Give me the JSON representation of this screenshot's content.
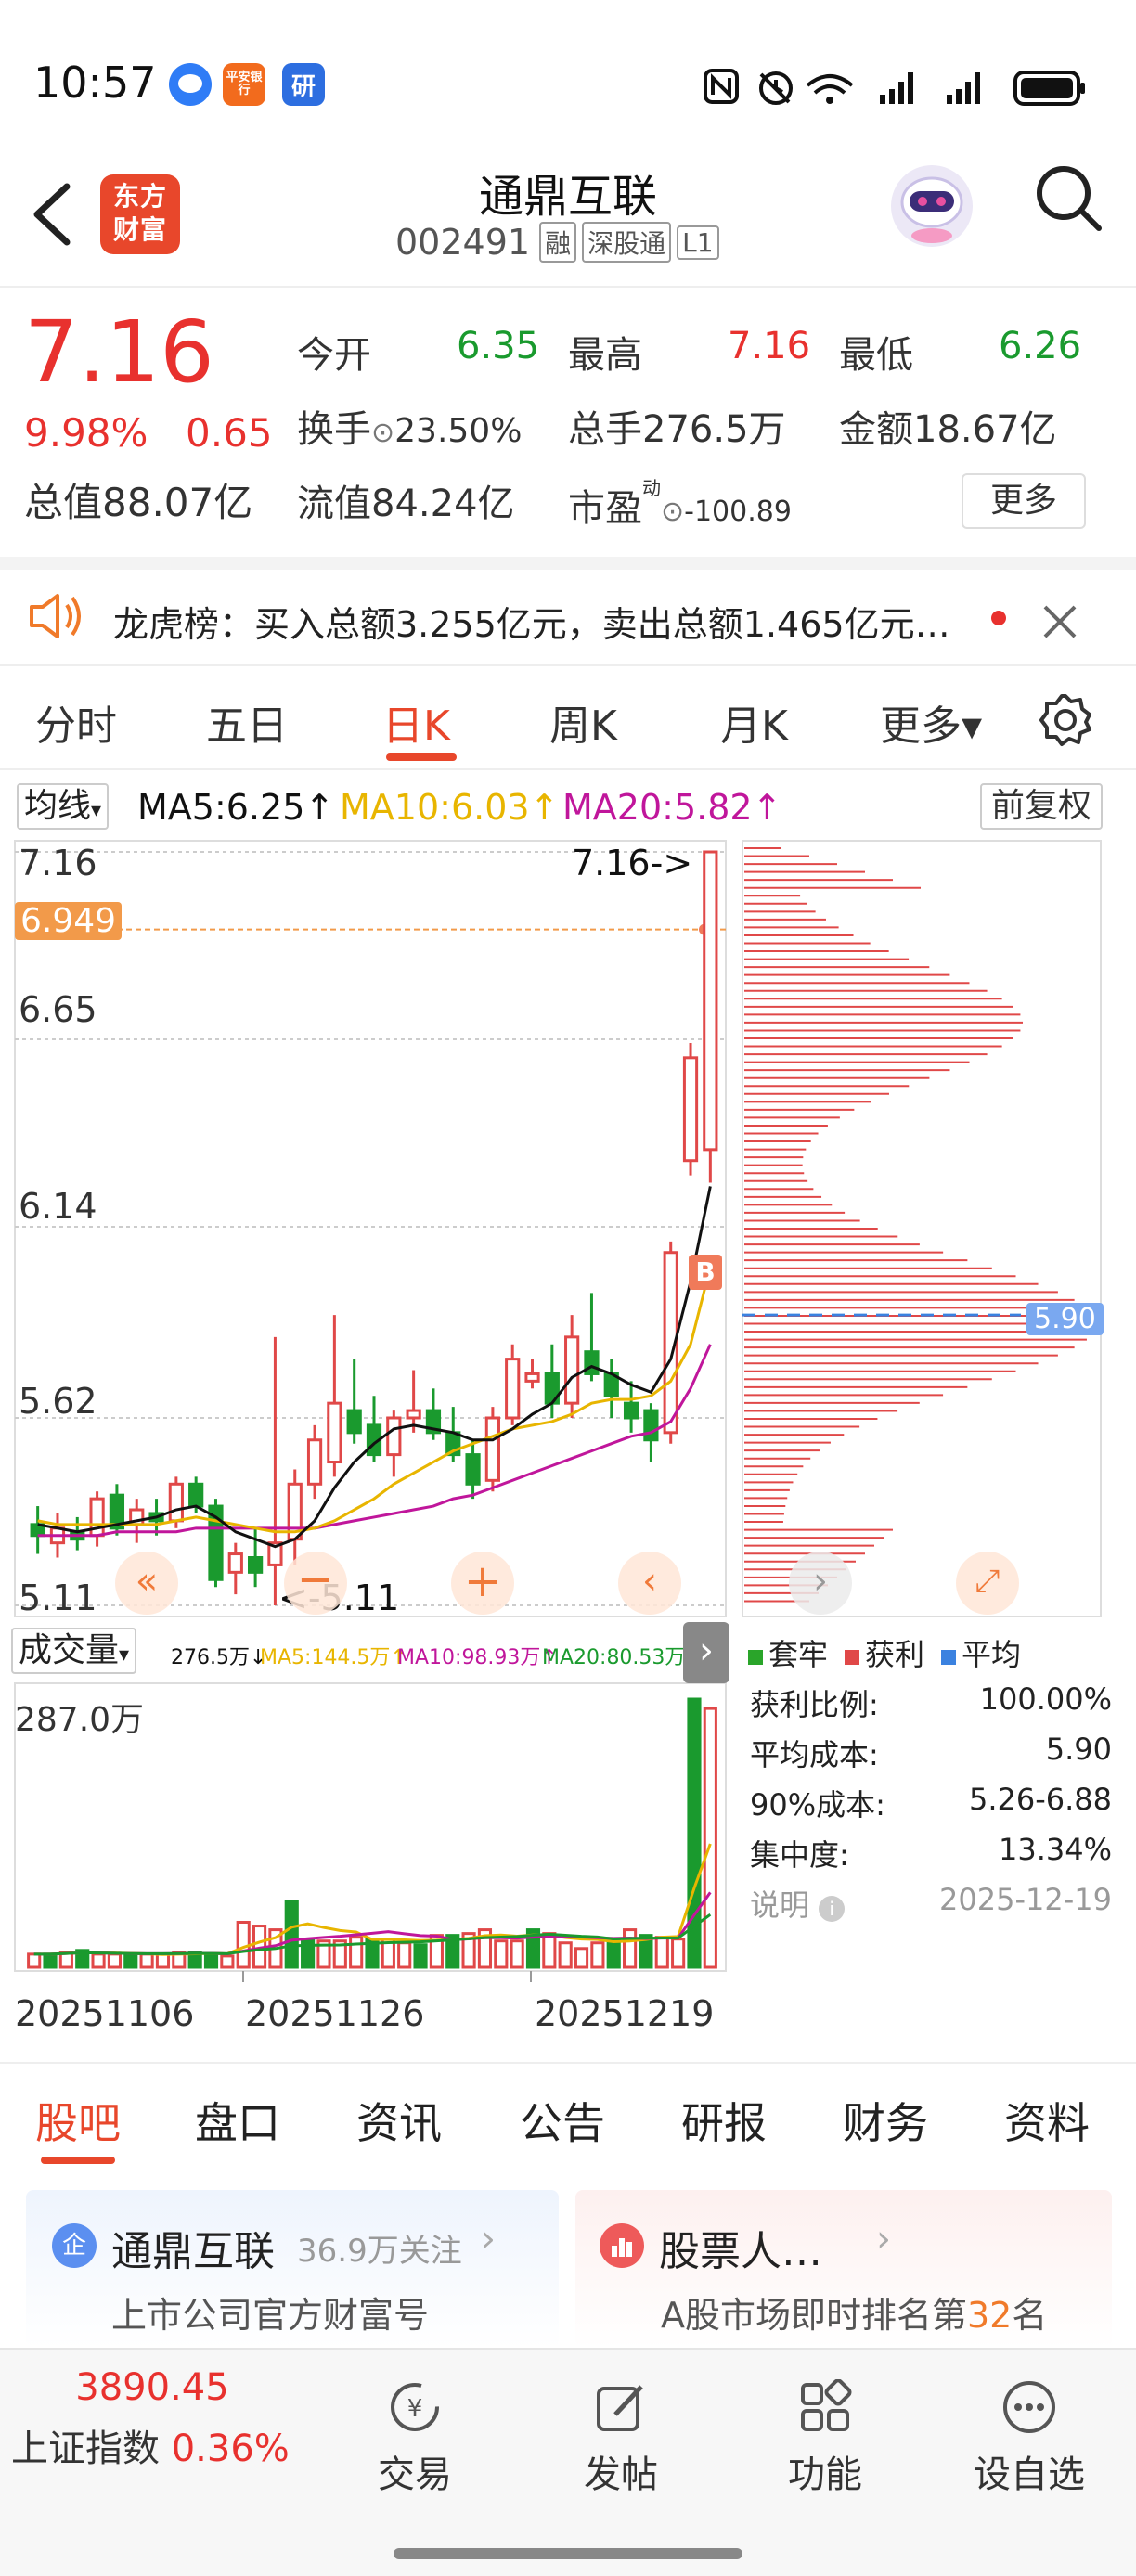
{
  "status_bar": {
    "time": "10:57",
    "app_icons": [
      "messages-icon",
      "pingan-bank-icon",
      "research-icon"
    ],
    "app_icon_labels": [
      "",
      "平安银行",
      "研"
    ],
    "right_icons": [
      "nfc-icon",
      "alarm-icon",
      "wifi-6-icon",
      "signal-icon",
      "signal-icon",
      "battery-icon"
    ]
  },
  "header": {
    "back_icon": "back-arrow-icon",
    "logo_text": "东方财富",
    "stock_name": "通鼎互联",
    "stock_code": "002491",
    "tags": [
      "融",
      "深股通",
      "L1"
    ],
    "avatar_icon": "robot-avatar-icon",
    "search_icon": "search-icon"
  },
  "quote": {
    "price": "7.16",
    "change_pct": "9.98%",
    "change_amt": "0.65",
    "market_cap_label": "总值",
    "market_cap": "88.07亿",
    "open_label": "今开",
    "open": "6.35",
    "high_label": "最高",
    "high": "7.16",
    "low_label": "最低",
    "low": "6.26",
    "turnover_label": "换手",
    "turnover": "23.50%",
    "volume_label": "总手",
    "volume": "276.5万",
    "amount_label": "金额",
    "amount": "18.67亿",
    "float_cap_label": "流值",
    "float_cap": "84.24亿",
    "pe_label": "市盈",
    "pe_sup": "动",
    "pe": "-100.89",
    "more_button": "更多"
  },
  "notice": {
    "icon": "speaker-icon",
    "text": "龙虎榜：买入总额3.255亿元，卖出总额1.465亿元…",
    "close_icon": "close-icon"
  },
  "chart_tabs": {
    "tabs": [
      "分时",
      "五日",
      "日K",
      "周K",
      "月K",
      "更多▾"
    ],
    "active": "日K",
    "settings_icon": "gear-icon"
  },
  "ma_row": {
    "selector": "均线",
    "ma5": "MA5:6.25↑",
    "ma10": "MA10:6.03↑",
    "ma20": "MA20:5.82↑",
    "adjust_button": "前复权",
    "colors": {
      "ma5": "#111111",
      "ma10": "#e8b500",
      "ma20": "#c0169b"
    }
  },
  "chart_data": {
    "type": "candlestick",
    "y_axis_labels": [
      "7.16",
      "6.65",
      "6.14",
      "5.62",
      "5.11"
    ],
    "ylim": [
      5.11,
      7.16
    ],
    "crosshair_price": "6.949",
    "max_annotation": "7.16->",
    "min_annotation": "<-5.11",
    "buy_marker": "B",
    "candles": [
      {
        "o": 5.33,
        "h": 5.38,
        "l": 5.25,
        "c": 5.3
      },
      {
        "o": 5.28,
        "h": 5.36,
        "l": 5.24,
        "c": 5.32
      },
      {
        "o": 5.31,
        "h": 5.35,
        "l": 5.26,
        "c": 5.29
      },
      {
        "o": 5.3,
        "h": 5.42,
        "l": 5.27,
        "c": 5.4
      },
      {
        "o": 5.41,
        "h": 5.44,
        "l": 5.3,
        "c": 5.32
      },
      {
        "o": 5.33,
        "h": 5.4,
        "l": 5.28,
        "c": 5.37
      },
      {
        "o": 5.36,
        "h": 5.4,
        "l": 5.3,
        "c": 5.34
      },
      {
        "o": 5.34,
        "h": 5.46,
        "l": 5.32,
        "c": 5.44
      },
      {
        "o": 5.44,
        "h": 5.46,
        "l": 5.36,
        "c": 5.38
      },
      {
        "o": 5.38,
        "h": 5.4,
        "l": 5.16,
        "c": 5.18
      },
      {
        "o": 5.2,
        "h": 5.28,
        "l": 5.14,
        "c": 5.25
      },
      {
        "o": 5.24,
        "h": 5.32,
        "l": 5.16,
        "c": 5.2
      },
      {
        "o": 5.22,
        "h": 5.84,
        "l": 5.11,
        "c": 5.28
      },
      {
        "o": 5.29,
        "h": 5.48,
        "l": 5.22,
        "c": 5.44
      },
      {
        "o": 5.44,
        "h": 5.6,
        "l": 5.4,
        "c": 5.56
      },
      {
        "o": 5.5,
        "h": 5.9,
        "l": 5.46,
        "c": 5.66
      },
      {
        "o": 5.64,
        "h": 5.78,
        "l": 5.55,
        "c": 5.58
      },
      {
        "o": 5.6,
        "h": 5.68,
        "l": 5.5,
        "c": 5.52
      },
      {
        "o": 5.52,
        "h": 5.64,
        "l": 5.46,
        "c": 5.62
      },
      {
        "o": 5.62,
        "h": 5.75,
        "l": 5.58,
        "c": 5.64
      },
      {
        "o": 5.64,
        "h": 5.7,
        "l": 5.56,
        "c": 5.58
      },
      {
        "o": 5.58,
        "h": 5.65,
        "l": 5.5,
        "c": 5.52
      },
      {
        "o": 5.52,
        "h": 5.56,
        "l": 5.4,
        "c": 5.44
      },
      {
        "o": 5.45,
        "h": 5.65,
        "l": 5.42,
        "c": 5.62
      },
      {
        "o": 5.62,
        "h": 5.82,
        "l": 5.6,
        "c": 5.78
      },
      {
        "o": 5.72,
        "h": 5.78,
        "l": 5.7,
        "c": 5.74
      },
      {
        "o": 5.74,
        "h": 5.82,
        "l": 5.62,
        "c": 5.66
      },
      {
        "o": 5.66,
        "h": 5.9,
        "l": 5.62,
        "c": 5.84
      },
      {
        "o": 5.8,
        "h": 5.96,
        "l": 5.72,
        "c": 5.74
      },
      {
        "o": 5.74,
        "h": 5.78,
        "l": 5.62,
        "c": 5.68
      },
      {
        "o": 5.66,
        "h": 5.72,
        "l": 5.58,
        "c": 5.62
      },
      {
        "o": 5.64,
        "h": 5.66,
        "l": 5.5,
        "c": 5.56
      },
      {
        "o": 5.58,
        "h": 6.1,
        "l": 5.55,
        "c": 6.07
      },
      {
        "o": 6.32,
        "h": 6.64,
        "l": 6.28,
        "c": 6.6
      },
      {
        "o": 6.35,
        "h": 7.16,
        "l": 6.26,
        "c": 7.16
      }
    ],
    "ma5": [
      5.33,
      5.32,
      5.31,
      5.32,
      5.33,
      5.34,
      5.35,
      5.37,
      5.38,
      5.35,
      5.31,
      5.29,
      5.27,
      5.29,
      5.34,
      5.43,
      5.5,
      5.55,
      5.59,
      5.6,
      5.59,
      5.58,
      5.56,
      5.56,
      5.59,
      5.63,
      5.66,
      5.73,
      5.76,
      5.74,
      5.71,
      5.69,
      5.78,
      5.99,
      6.25
    ],
    "ma10": [
      5.34,
      5.33,
      5.33,
      5.33,
      5.33,
      5.33,
      5.33,
      5.34,
      5.35,
      5.34,
      5.33,
      5.32,
      5.31,
      5.31,
      5.32,
      5.34,
      5.37,
      5.4,
      5.44,
      5.47,
      5.5,
      5.53,
      5.55,
      5.57,
      5.59,
      5.6,
      5.61,
      5.63,
      5.66,
      5.67,
      5.67,
      5.68,
      5.72,
      5.82,
      6.03
    ],
    "ma20": [
      5.3,
      5.3,
      5.3,
      5.3,
      5.31,
      5.31,
      5.31,
      5.31,
      5.32,
      5.32,
      5.32,
      5.32,
      5.32,
      5.32,
      5.32,
      5.33,
      5.34,
      5.35,
      5.36,
      5.37,
      5.38,
      5.4,
      5.41,
      5.43,
      5.45,
      5.47,
      5.49,
      5.51,
      5.53,
      5.55,
      5.57,
      5.58,
      5.61,
      5.7,
      5.82
    ],
    "volume_max_label": "287.0万",
    "volumes": [
      14,
      14,
      16,
      18,
      14,
      14,
      12,
      14,
      14,
      16,
      16,
      14,
      12,
      48,
      44,
      40,
      70,
      30,
      28,
      28,
      32,
      30,
      30,
      26,
      24,
      34,
      34,
      36,
      40,
      28,
      28,
      40,
      36,
      26,
      20,
      26,
      28,
      40,
      34,
      32,
      30,
      286,
      276
    ],
    "x_labels": [
      "20251106",
      "20251126",
      "20251219"
    ],
    "chip_avg_cost": "5.90"
  },
  "chart_controls": {
    "left_icon": "double-chevron-left-icon",
    "zoom_out_icon": "minus-icon",
    "zoom_in_icon": "plus-icon",
    "prev_icon": "chevron-left-icon",
    "next_icon": "chevron-right-icon",
    "expand_icon": "expand-icon",
    "collapse_icon": "chevron-right-icon"
  },
  "volume_header": {
    "selector": "成交量",
    "vol": "276.5万↓",
    "ma5": "MA5:144.5万↑",
    "ma10": "MA10:98.93万↑",
    "ma20": "MA20:80.53万↑"
  },
  "chips": {
    "legend": [
      "套牢",
      "获利",
      "平均"
    ],
    "legend_colors": [
      "#2aa52a",
      "#e04848",
      "#3b82e0"
    ],
    "rows": [
      {
        "label": "获利比例:",
        "value": "100.00%"
      },
      {
        "label": "平均成本:",
        "value": "5.90"
      },
      {
        "label": "90%成本:",
        "value": "5.26-6.88"
      },
      {
        "label": "集中度:",
        "value": "13.34%"
      }
    ],
    "note_label": "说明",
    "note_date": "2025-12-19"
  },
  "bottom_tabs": {
    "tabs": [
      "股吧",
      "盘口",
      "资讯",
      "公告",
      "研报",
      "财务",
      "资料"
    ],
    "active": "股吧"
  },
  "cards": {
    "left_title": "通鼎互联",
    "left_follow": "36.9万关注",
    "left_sub": "上市公司官方财富号",
    "right_title": "股票人…",
    "right_sub_prefix": "A股市场即时排名第",
    "right_rank": "32",
    "right_sub_suffix": "名"
  },
  "footer": {
    "index_value": "3890.45",
    "index_name": "上证指数",
    "index_change": "0.36%",
    "items": [
      "交易",
      "发帖",
      "功能",
      "设自选"
    ]
  }
}
